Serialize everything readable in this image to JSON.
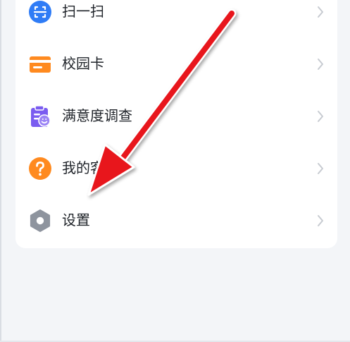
{
  "menu": {
    "items": [
      {
        "label": "扫一扫",
        "icon": "scan-icon",
        "color": "#2f7cf6"
      },
      {
        "label": "校园卡",
        "icon": "campus-card-icon",
        "color": "#ff8a1f"
      },
      {
        "label": "满意度调查",
        "icon": "survey-clipboard-icon",
        "color": "#7a5cf0"
      },
      {
        "label": "我的客服",
        "icon": "help-question-icon",
        "color": "#ff8a1f"
      },
      {
        "label": "设置",
        "icon": "settings-gear-icon",
        "color": "#8e949e"
      }
    ]
  },
  "colors": {
    "background": "#f3f5f8",
    "card": "#ffffff",
    "chevron": "#c7cbd1",
    "annotation_arrow": "#e8141b"
  }
}
